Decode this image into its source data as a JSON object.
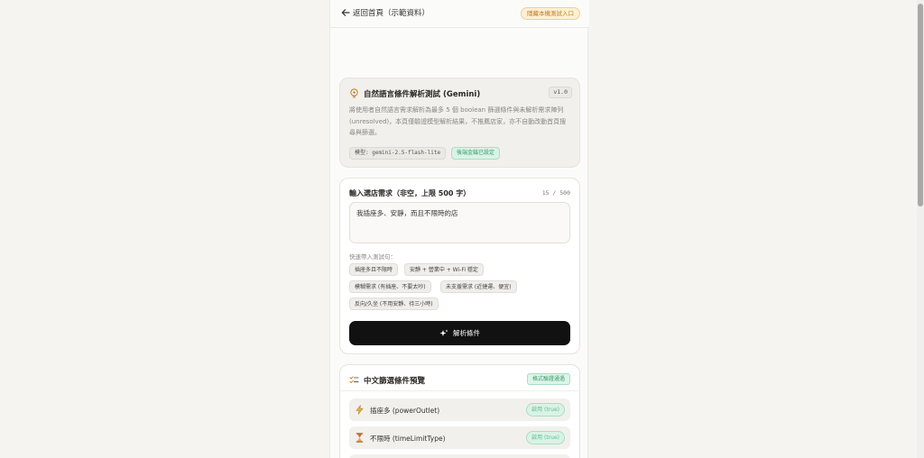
{
  "topbar": {
    "back_label": "返回首頁（示範資料）",
    "entry_badge": "隱藏本機測試入口"
  },
  "gemini_card": {
    "icon": "lightbulb-icon",
    "title": "自然語言條件解析測試 (Gemini)",
    "version": "v1.0",
    "description": "將使用者自然語言需求解析為最多 5 個 boolean 篩選條件與未解析需求陣列 (unresolved)，本頁僅驗證模型解析結果，不推薦店家，亦不自動改動首頁搜尋與篩選。",
    "model": "模型: gemini-2.5-flash-lite",
    "key_status": "後端金鑰已設定"
  },
  "input_card": {
    "label": "輸入選店需求（非空，上限 500 字）",
    "counter": "15 / 500",
    "query_value": "我插座多、安靜，而且不限時的店",
    "quick_label": "快速帶入測試句：",
    "chips": [
      "插座多且不限時",
      "安靜 + 營業中 + Wi-Fi 穩定",
      "模糊需求 (有插座、不要太吵)",
      "未支援需求 (近捷運、便宜)",
      "反向/久坐 (不用安靜、待三小時)"
    ],
    "parse_button": "解析條件"
  },
  "preview_card": {
    "icon": "checklist-icon",
    "title": "中文篩選條件預覽",
    "badge": "格式驗證通過",
    "conditions": [
      {
        "icon": "lightning-icon",
        "label": "插座多 (powerOutlet)",
        "value": "啟用 (true)"
      },
      {
        "icon": "hourglass-icon",
        "label": "不限時 (timeLimitType)",
        "value": "啟用 (true)"
      }
    ]
  },
  "colors": {
    "accent_green": "#3a9a6a",
    "badge_orange": "#c27d1a",
    "button_dark": "#111111"
  }
}
